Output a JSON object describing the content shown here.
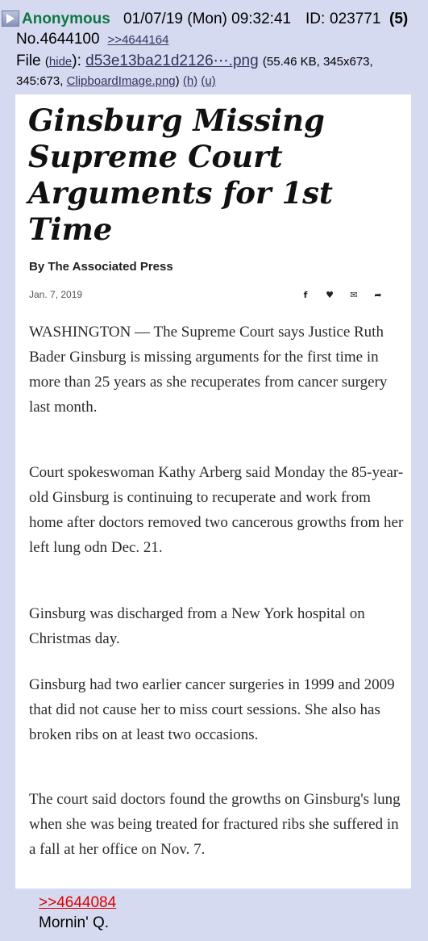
{
  "post": {
    "name": "Anonymous",
    "date": "01/07/19 (Mon) 09:32:41",
    "id_label": "ID:",
    "id": "023771",
    "id_count": "(5)",
    "number": "No.4644100",
    "reply_link": ">>4644164",
    "file": {
      "label": "File",
      "hide_open": "(",
      "hide": "hide",
      "hide_close": "):",
      "filename": "d53e13ba21d2126⋯.png",
      "meta": "(55.46 KB, 345x673,",
      "meta2": "345:673,",
      "original": "ClipboardImage.png",
      "paren_close": ")",
      "h": "(h)",
      "u": "(u)"
    },
    "body": {
      "quote": ">>4644084",
      "text": "Mornin' Q."
    }
  },
  "article": {
    "headline": "Ginsburg Missing Supreme Court Arguments for 1st Time",
    "byline": "By The Associated Press",
    "date": "Jan. 7, 2019",
    "share_icons": [
      "f",
      "♥",
      "✉",
      "➦"
    ],
    "paragraphs": [
      "WASHINGTON — The Supreme Court says Justice Ruth Bader Ginsburg is missing arguments for the first time in more than 25 years as she recuperates from cancer surgery last month.",
      "Court spokeswoman Kathy Arberg said Monday the 85-year-old Ginsburg is continuing to recuperate and work from home after doctors removed two cancerous growths from her left lung odn Dec. 21.",
      "Ginsburg was discharged from a New York hospital on Christmas day.",
      "Ginsburg had two earlier cancer surgeries in 1999 and 2009 that did not cause her to miss court sessions. She also has broken ribs on at least two occasions.",
      "The court said doctors found the growths on Ginsburg's lung when she was being treated for fractured ribs she suffered in a fall at her office on Nov. 7."
    ]
  },
  "colors": {
    "background": "#d6daf0",
    "name": "#117743",
    "link": "#34345c",
    "quote": "#dd0000"
  }
}
